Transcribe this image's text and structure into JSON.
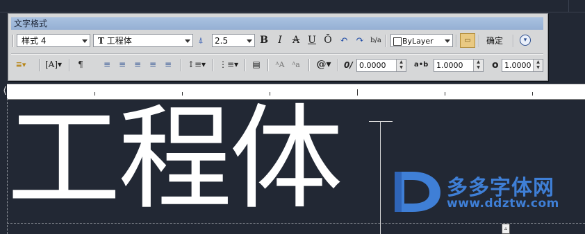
{
  "toolbar": {
    "title": "文字格式",
    "style_dropdown": "样式 4",
    "font_dropdown": "工程体",
    "font_prefix": "T",
    "height_dropdown": "2.5",
    "bold_label": "B",
    "italic_label": "I",
    "strike_label": "A",
    "underline_label": "U",
    "overline_label": "Ō",
    "undo_label": "↶",
    "redo_label": "↷",
    "stack_label": "b/a",
    "color_dropdown": "ByLayer",
    "ok_label": "确定",
    "oblique_value": "0.0000",
    "tracking_value": "1.0000",
    "width_value": "1.0000",
    "oblique_label": "0/",
    "tracking_label": "a•b",
    "width_label": "o"
  },
  "editor": {
    "text": "工程体"
  },
  "watermark": {
    "title": "多多字体网",
    "url": "www.ddztw.com"
  }
}
